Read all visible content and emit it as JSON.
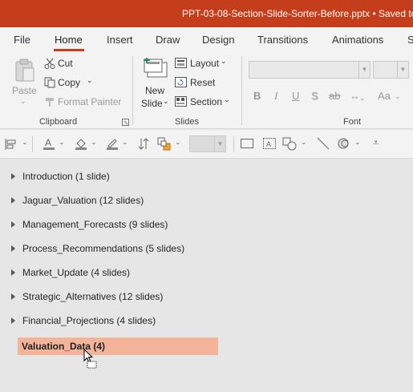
{
  "titlebar": {
    "title": "PPT-03-08-Section-Slide-Sorter-Before.pptx  •  Saved to"
  },
  "tabs": [
    {
      "label": "File"
    },
    {
      "label": "Home"
    },
    {
      "label": "Insert"
    },
    {
      "label": "Draw"
    },
    {
      "label": "Design"
    },
    {
      "label": "Transitions"
    },
    {
      "label": "Animations"
    },
    {
      "label": "S"
    }
  ],
  "ribbon": {
    "clipboard": {
      "paste": "Paste",
      "cut": "Cut",
      "copy": "Copy",
      "format_painter": "Format Painter",
      "group_label": "Clipboard"
    },
    "slides": {
      "new_slide_1": "New",
      "new_slide_2": "Slide",
      "layout": "Layout",
      "reset": "Reset",
      "section": "Section",
      "group_label": "Slides"
    },
    "font": {
      "bold": "B",
      "italic": "I",
      "underline": "U",
      "shadow": "S",
      "strikethrough": "ab",
      "case": "Aa",
      "group_label": "Font"
    }
  },
  "sections": [
    {
      "label": "Introduction (1 slide)"
    },
    {
      "label": "Jaguar_Valuation (12 slides)"
    },
    {
      "label": "Management_Forecasts (9 slides)"
    },
    {
      "label": "Process_Recommendations (5 slides)"
    },
    {
      "label": "Market_Update (4 slides)"
    },
    {
      "label": "Strategic_Alternatives (12 slides)"
    },
    {
      "label": "Financial_Projections (4 slides)"
    }
  ],
  "dragging_section": {
    "label": "Valuation_Data (4)"
  },
  "colors": {
    "accent": "#c43e1c",
    "drag_highlight": "#f4b49a"
  }
}
